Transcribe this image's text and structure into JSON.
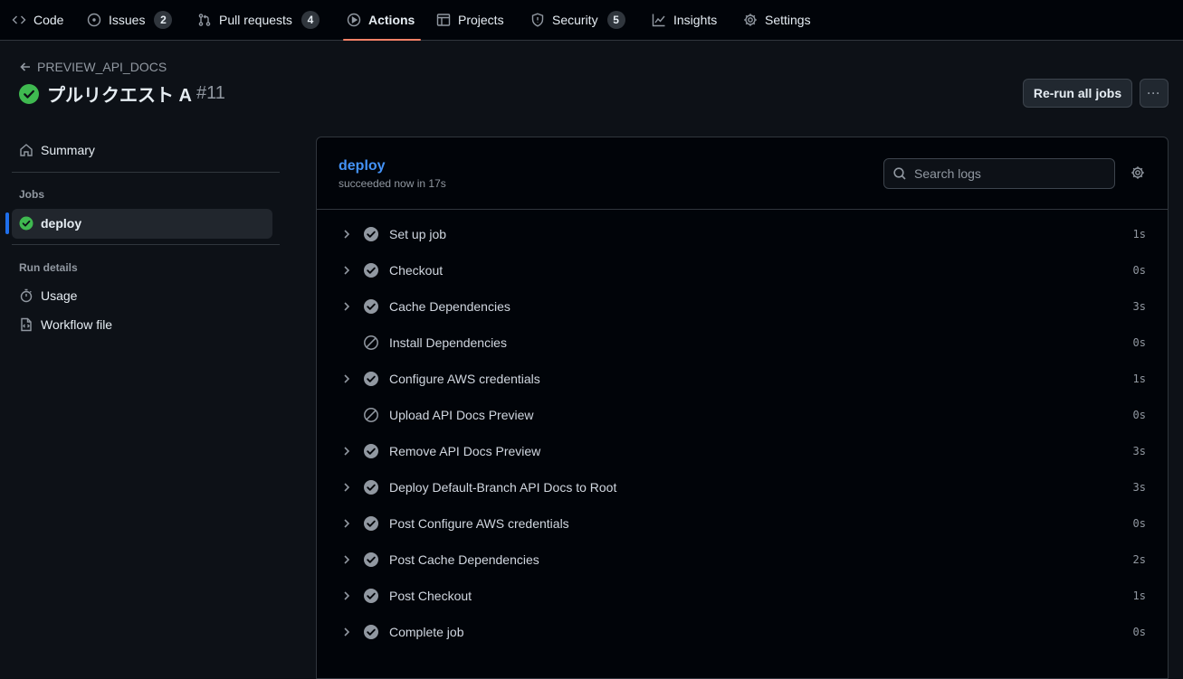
{
  "nav": {
    "tabs": [
      {
        "label": "Code",
        "icon": "code-icon"
      },
      {
        "label": "Issues",
        "icon": "issue-opened-icon",
        "count": "2"
      },
      {
        "label": "Pull requests",
        "icon": "git-pull-request-icon",
        "count": "4"
      },
      {
        "label": "Actions",
        "icon": "play-icon",
        "active": true
      },
      {
        "label": "Projects",
        "icon": "table-icon"
      },
      {
        "label": "Security",
        "icon": "shield-icon",
        "count": "5"
      },
      {
        "label": "Insights",
        "icon": "graph-icon"
      },
      {
        "label": "Settings",
        "icon": "gear-icon"
      }
    ]
  },
  "header": {
    "workflow_name": "PREVIEW_API_DOCS",
    "run_title": "プルリクエスト A",
    "run_number": "#11",
    "rerun_label": "Re-run all jobs",
    "more_label": "···"
  },
  "sidebar": {
    "summary_label": "Summary",
    "jobs_heading": "Jobs",
    "jobs": [
      {
        "label": "deploy",
        "status": "success"
      }
    ],
    "run_details_heading": "Run details",
    "usage_label": "Usage",
    "workflow_file_label": "Workflow file"
  },
  "job": {
    "name": "deploy",
    "status_text": "succeeded now in 17s",
    "search_placeholder": "Search logs",
    "steps": [
      {
        "label": "Set up job",
        "duration": "1s",
        "status": "success",
        "expandable": true
      },
      {
        "label": "Checkout",
        "duration": "0s",
        "status": "success",
        "expandable": true
      },
      {
        "label": "Cache Dependencies",
        "duration": "3s",
        "status": "success",
        "expandable": true
      },
      {
        "label": "Install Dependencies",
        "duration": "0s",
        "status": "skipped",
        "expandable": false
      },
      {
        "label": "Configure AWS credentials",
        "duration": "1s",
        "status": "success",
        "expandable": true
      },
      {
        "label": "Upload API Docs Preview",
        "duration": "0s",
        "status": "skipped",
        "expandable": false
      },
      {
        "label": "Remove API Docs Preview",
        "duration": "3s",
        "status": "success",
        "expandable": true
      },
      {
        "label": "Deploy Default-Branch API Docs to Root",
        "duration": "3s",
        "status": "success",
        "expandable": true
      },
      {
        "label": "Post Configure AWS credentials",
        "duration": "0s",
        "status": "success",
        "expandable": true
      },
      {
        "label": "Post Cache Dependencies",
        "duration": "2s",
        "status": "success",
        "expandable": true
      },
      {
        "label": "Post Checkout",
        "duration": "1s",
        "status": "success",
        "expandable": true
      },
      {
        "label": "Complete job",
        "duration": "0s",
        "status": "success",
        "expandable": true
      }
    ]
  },
  "colors": {
    "success_green": "#3fb950",
    "step_done_gray": "#9198a1",
    "link_blue": "#4493f8",
    "active_tab_underline": "#f78166"
  }
}
